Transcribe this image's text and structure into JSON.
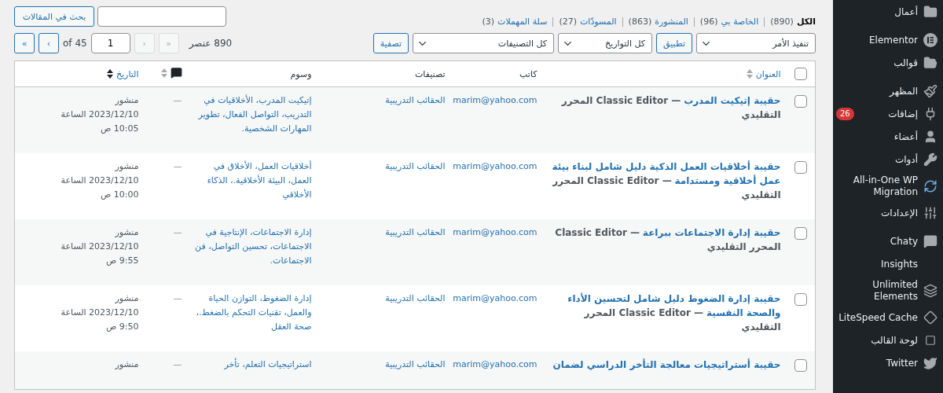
{
  "sidebar": {
    "groups": [
      [
        {
          "label": "أعمال"
        }
      ],
      [
        {
          "label": "Elementor"
        },
        {
          "label": "قوالب"
        }
      ],
      [
        {
          "label": "المظهر"
        },
        {
          "label": "إضافات",
          "badge": "26"
        },
        {
          "label": "أعضاء"
        },
        {
          "label": "أدوات"
        },
        {
          "label": "All-in-One WP Migration"
        },
        {
          "label": "الإعدادات"
        }
      ],
      [
        {
          "label": "Chaty"
        },
        {
          "label": "Insights"
        },
        {
          "label": "Unlimited Elements"
        },
        {
          "label": "LiteSpeed Cache"
        },
        {
          "label": "لوحة القالب"
        },
        {
          "label": "Twitter"
        }
      ]
    ]
  },
  "views": [
    {
      "label": "الكل",
      "count": "(890)",
      "selected": true
    },
    {
      "label": "الخاصة بي",
      "count": "(96)",
      "selected": false
    },
    {
      "label": "المنشورة",
      "count": "(863)",
      "selected": false
    },
    {
      "label": "المسودّات",
      "count": "(27)",
      "selected": false
    },
    {
      "label": "سلة المهملات",
      "count": "(3)",
      "selected": false
    }
  ],
  "search": {
    "button": "بحث في المقالات"
  },
  "filters": {
    "bulk_action": "تنفيذ الأمر",
    "apply": "تطبيق",
    "date": "كل التواريخ",
    "category": "كل التصنيفات",
    "filter": "تصفية"
  },
  "pagination": {
    "count": "890 عنصر",
    "before": [
      {
        "label": "«",
        "disabled": true
      },
      {
        "label": "‹",
        "disabled": true
      }
    ],
    "page": "1",
    "of": "of 45",
    "after": [
      {
        "label": "›",
        "disabled": false
      },
      {
        "label": "»",
        "disabled": false
      }
    ]
  },
  "table": {
    "select_all_checked": false,
    "columns": [
      {
        "label": "العنوان",
        "kind": "sortable",
        "sorted": false
      },
      {
        "label": "كاتب",
        "kind": "plain"
      },
      {
        "label": "تصنيفات",
        "kind": "plain"
      },
      {
        "label": "وسوم",
        "kind": "plain"
      },
      {
        "kind": "comments",
        "sorted": false
      },
      {
        "label": "التاريخ",
        "kind": "sortable",
        "sorted": true
      }
    ],
    "rows": [
      {
        "checked": false,
        "title": "حقيبة إتيكيت المدرب",
        "state": "— Classic Editor المحرر التقليدي",
        "author": "marim@yahoo.com",
        "category": "الحقائب التدريبية",
        "tags": "إتيكيت المدرب، الأخلاقيات في التدريب، التواصل الفعال، تطوير المهارات الشخصية.",
        "comments": "—",
        "status": "منشور",
        "date": "2023/12/10 الساعة 10:05 ص"
      },
      {
        "checked": false,
        "title": "حقيبة أخلاقيات العمل الذكية دليل شامل لبناء بيئة عمل أخلاقية ومستدامة",
        "state": "— Classic Editor المحرر التقليدي",
        "author": "marim@yahoo.com",
        "category": "الحقائب التدريبية",
        "tags": "أخلاقيات العمل، الأخلاق في العمل، البيئة الأخلاقية.، الذكاء الأخلاقي",
        "comments": "—",
        "status": "منشور",
        "date": "2023/12/10 الساعة 10:00 ص"
      },
      {
        "checked": false,
        "title": "حقيبة إدارة الاجتماعات ببراعة",
        "state": "— Classic Editor المحرر التقليدي",
        "author": "marim@yahoo.com",
        "category": "الحقائب التدريبية",
        "tags": "إدارة الاجتماعات، الإنتاجية في الاجتماعات، تحسين التواصل، فن الاجتماعات.",
        "comments": "—",
        "status": "منشور",
        "date": "2023/12/10 الساعة 9:55 ص"
      },
      {
        "checked": false,
        "title": "حقيبة إدارة الضغوط دليل شامل لتحسين الأداء والصحة النفسية",
        "state": "— Classic Editor المحرر التقليدي",
        "author": "marim@yahoo.com",
        "category": "الحقائب التدريبية",
        "tags": "إدارة الضغوط، التوازن الحياة والعمل، تقنيات التحكم بالضغط.، صحة العقل",
        "comments": "—",
        "status": "منشور",
        "date": "2023/12/10 الساعة 9:50 ص"
      },
      {
        "checked": false,
        "title": "حقيبة أستراتيجيات معالجة التأخر الدراسي لضمان",
        "author": "marim@yahoo.com",
        "category": "الحقائب التدريبية",
        "tags": "استراتيجيات التعلم، تأخر",
        "comments": "—",
        "status": "منشور"
      }
    ]
  }
}
